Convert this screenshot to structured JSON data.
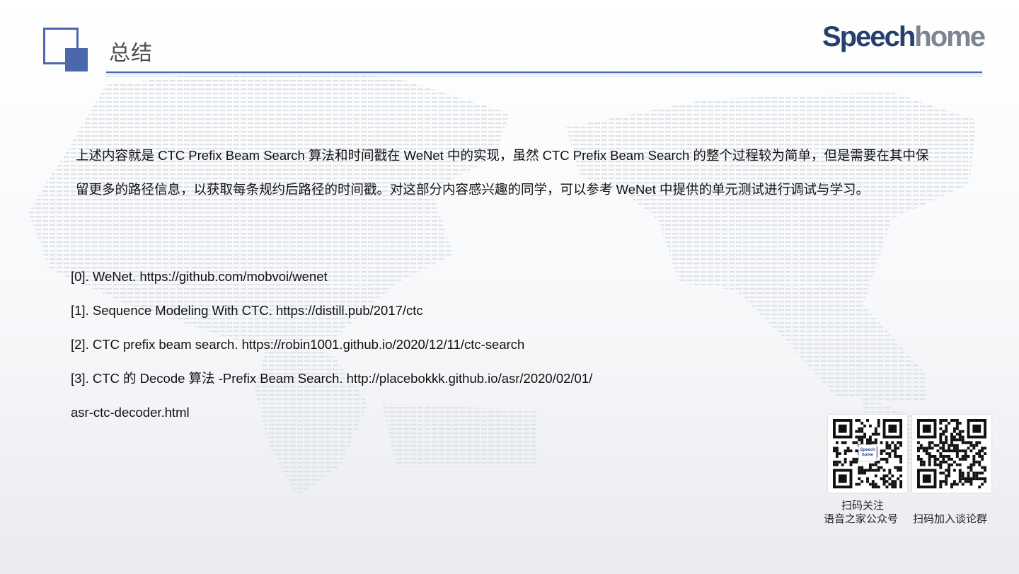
{
  "header": {
    "title": "总结",
    "brand_part1": "Speech",
    "brand_part2": "home"
  },
  "intro_text": "上述内容就是 CTC Prefix Beam Search 算法和时间戳在 WeNet 中的实现，虽然 CTC Prefix Beam Search 的整个过程较为简单，但是需要在其中保留更多的路径信息，以获取每条规约后路径的时间戳。对这部分内容感兴趣的同学，可以参考 WeNet 中提供的单元测试进行调试与学习。",
  "references": [
    "[0]. WeNet. https://github.com/mobvoi/wenet",
    "[1]. Sequence Modeling With CTC. https://distill.pub/2017/ctc",
    "[2]. CTC prefix beam search. https://robin1001.github.io/2020/12/11/ctc-search",
    "[3]. CTC 的 Decode 算法 -Prefix Beam Search. http://placebokkk.github.io/asr/2020/02/01/",
    "asr-ctc-decoder.html"
  ],
  "qr_codes": [
    {
      "caption_line1": "扫码关注",
      "caption_line2": "语音之家公众号"
    },
    {
      "caption": "扫码加入谈论群"
    }
  ],
  "colors": {
    "accent": "#4a68ab",
    "brand_dark": "#25406f",
    "brand_grey": "#7c8592"
  }
}
